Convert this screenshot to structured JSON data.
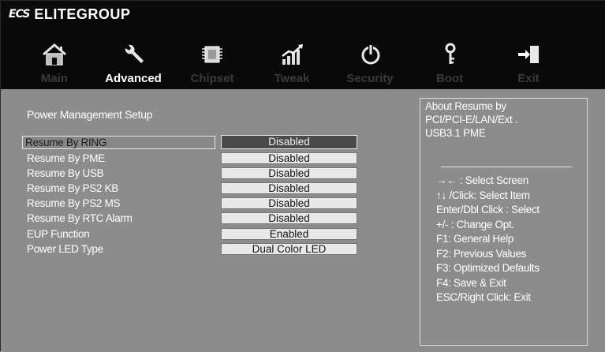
{
  "header": {
    "brand_mark": "ECS",
    "brand_name": "ELITEGROUP"
  },
  "icons": [
    "home-icon",
    "wrench-icon",
    "chip-icon",
    "chart-icon",
    "power-icon",
    "key-icon",
    "exit-icon"
  ],
  "tabs": [
    {
      "label": "Main",
      "active": false
    },
    {
      "label": "Advanced",
      "active": true
    },
    {
      "label": "Chipset",
      "active": false
    },
    {
      "label": "Tweak",
      "active": false
    },
    {
      "label": "Security",
      "active": false
    },
    {
      "label": "Boot",
      "active": false
    },
    {
      "label": "Exit",
      "active": false
    }
  ],
  "section_title": "Power Management Setup",
  "settings": [
    {
      "label": "Resume By RING",
      "value": "Disabled",
      "selected": true
    },
    {
      "label": "Resume By PME",
      "value": "Disabled",
      "selected": false
    },
    {
      "label": "Resume By USB",
      "value": "Disabled",
      "selected": false
    },
    {
      "label": "Resume By  PS2 KB",
      "value": "Disabled",
      "selected": false
    },
    {
      "label": "Resume By  PS2 MS",
      "value": "Disabled",
      "selected": false
    },
    {
      "label": "Resume By  RTC Alarm",
      "value": "Disabled",
      "selected": false
    },
    {
      "label": "EUP Function",
      "value": "Enabled",
      "selected": false
    },
    {
      "label": "Power LED Type",
      "value": "Dual Color LED",
      "selected": false
    }
  ],
  "help": {
    "about_line1": "About Resume by",
    "about_line2": "PCI/PCI-E/LAN/Ext .",
    "about_line3": "USB3.1 PME",
    "keys": [
      "→←   : Select Screen",
      "↑↓ /Click: Select Item",
      "Enter/Dbl Click : Select",
      "+/- : Change Opt.",
      "F1: General Help",
      "F2: Previous Values",
      "F3: Optimized Defaults",
      "F4: Save & Exit",
      "ESC/Right Click: Exit"
    ]
  },
  "colors": {
    "topbar": "#0a0a0a",
    "panel": "#8c8c8c",
    "tab_inactive": "#3a3a3a",
    "tab_active": "#ffffff",
    "value_bg": "#e8e8e8",
    "value_selected_bg": "#4a4a4a"
  }
}
